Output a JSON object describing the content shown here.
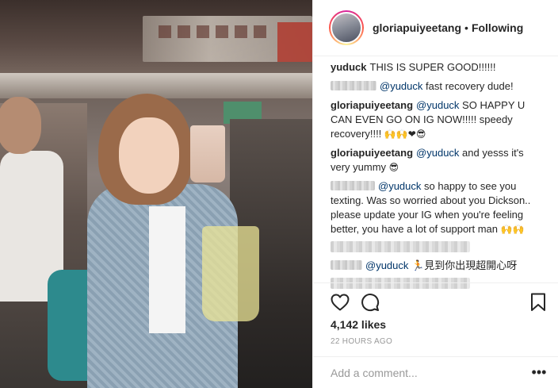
{
  "header": {
    "username": "gloriapuiyeetang",
    "separator": "•",
    "follow_state": "Following"
  },
  "comments": [
    {
      "user": "yuduck",
      "text": "THIS IS SUPER GOOD!!!!!!"
    },
    {
      "user_blurred": true,
      "mention": "@yuduck",
      "text": "fast recovery dude!"
    },
    {
      "user": "gloriapuiyeetang",
      "mention": "@yuduck",
      "text": "SO HAPPY U CAN EVEN GO ON IG NOW!!!!! speedy recovery!!!! ",
      "emoji": "🙌🙌❤😎"
    },
    {
      "user": "gloriapuiyeetang",
      "mention": "@yuduck",
      "text": "and yesss it's very yummy ",
      "emoji": "😎"
    },
    {
      "user_blurred": true,
      "mention": "@yuduck",
      "text": "so happy to see you texting. Was so worried about you Dickson.. please update your IG when you're feeling better, you have a lot of support man ",
      "emoji": "🙌🙌"
    },
    {
      "user_blurred": true,
      "mention": "@yuduck",
      "text": "🏃見到你出現超開心呀"
    }
  ],
  "actions": {
    "like_icon": "heart-icon",
    "comment_icon": "speech-bubble-icon",
    "save_icon": "bookmark-icon"
  },
  "likes": "4,142 likes",
  "timestamp": "22 HOURS AGO",
  "add_comment": {
    "placeholder": "Add a comment...",
    "more_label": "•••"
  }
}
